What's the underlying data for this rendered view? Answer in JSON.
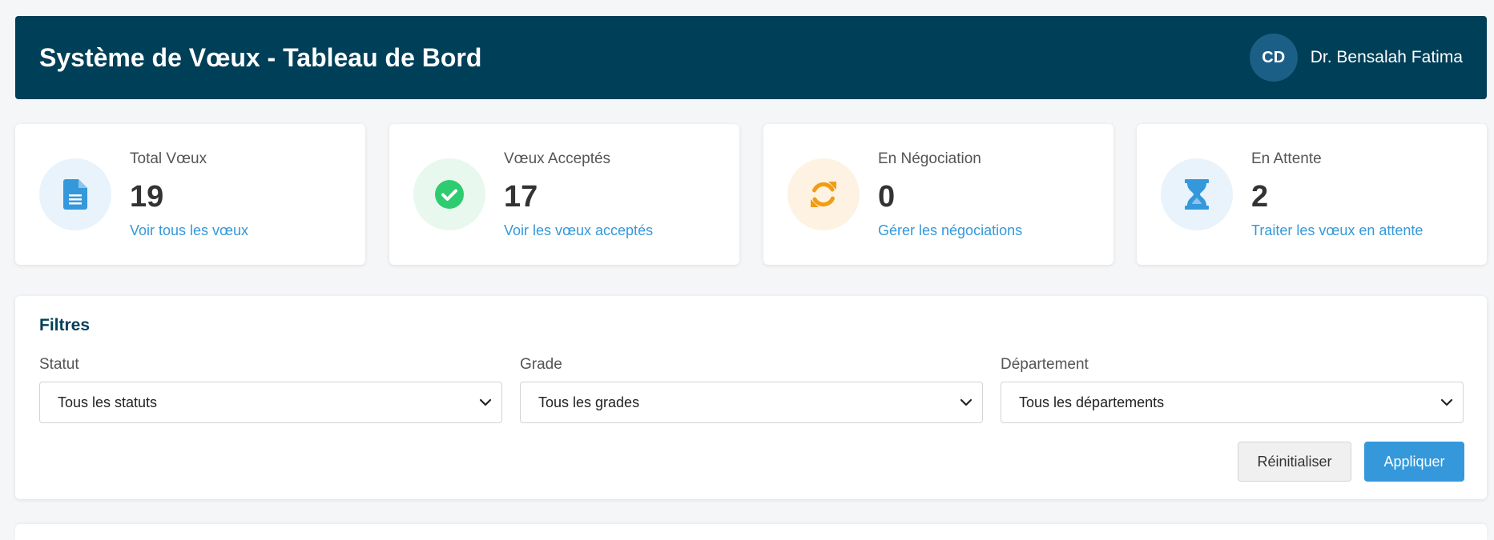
{
  "header": {
    "title": "Système de Vœux - Tableau de Bord",
    "user_initials": "CD",
    "user_name": "Dr. Bensalah Fatima"
  },
  "stats": [
    {
      "label": "Total Vœux",
      "value": "19",
      "link": "Voir tous les vœux",
      "icon": "document-icon",
      "accent": "#3498db",
      "bg": "#e8f3fb"
    },
    {
      "label": "Vœux Acceptés",
      "value": "17",
      "link": "Voir les vœux acceptés",
      "icon": "check-circle-icon",
      "accent": "#2ecc71",
      "bg": "#e8f8ee"
    },
    {
      "label": "En Négociation",
      "value": "0",
      "link": "Gérer les négociations",
      "icon": "sync-icon",
      "accent": "#f39c12",
      "bg": "#fef3e2"
    },
    {
      "label": "En Attente",
      "value": "2",
      "link": "Traiter les vœux en attente",
      "icon": "hourglass-icon",
      "accent": "#3498db",
      "bg": "#e8f3fb"
    }
  ],
  "filters": {
    "title": "Filtres",
    "statut": {
      "label": "Statut",
      "value": "Tous les statuts"
    },
    "grade": {
      "label": "Grade",
      "value": "Tous les grades"
    },
    "departement": {
      "label": "Département",
      "value": "Tous les départements"
    },
    "reset_label": "Réinitialiser",
    "apply_label": "Appliquer"
  },
  "colors": {
    "header_bg": "#003f58",
    "primary": "#3498db"
  }
}
